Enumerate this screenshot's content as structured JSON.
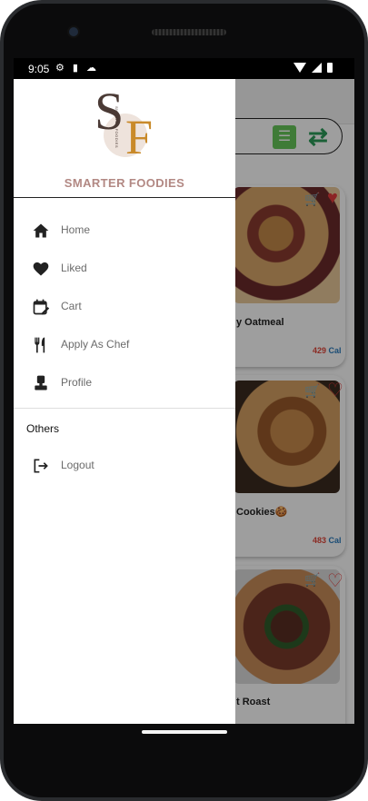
{
  "status_bar": {
    "time": "9:05"
  },
  "background": {
    "cards": [
      {
        "title": "y Oatmeal",
        "calories": "429",
        "unit": "Cal"
      },
      {
        "title": "Cookies🍪",
        "calories": "483",
        "unit": "Cal"
      },
      {
        "title": "t Roast"
      }
    ]
  },
  "drawer": {
    "brand_name": "SMARTER FOODIES",
    "logo_letter_s": "S",
    "logo_letter_f": "F",
    "logo_small_text": "SMARTER FOODIES",
    "menu": {
      "home": "Home",
      "liked": "Liked",
      "cart": "Cart",
      "apply_as_chef": "Apply As Chef",
      "profile": "Profile"
    },
    "others_title": "Others",
    "logout": "Logout"
  },
  "colors": {
    "brand": "#b28883",
    "accent_green": "#66c75a",
    "heart": "#e23b3b"
  }
}
